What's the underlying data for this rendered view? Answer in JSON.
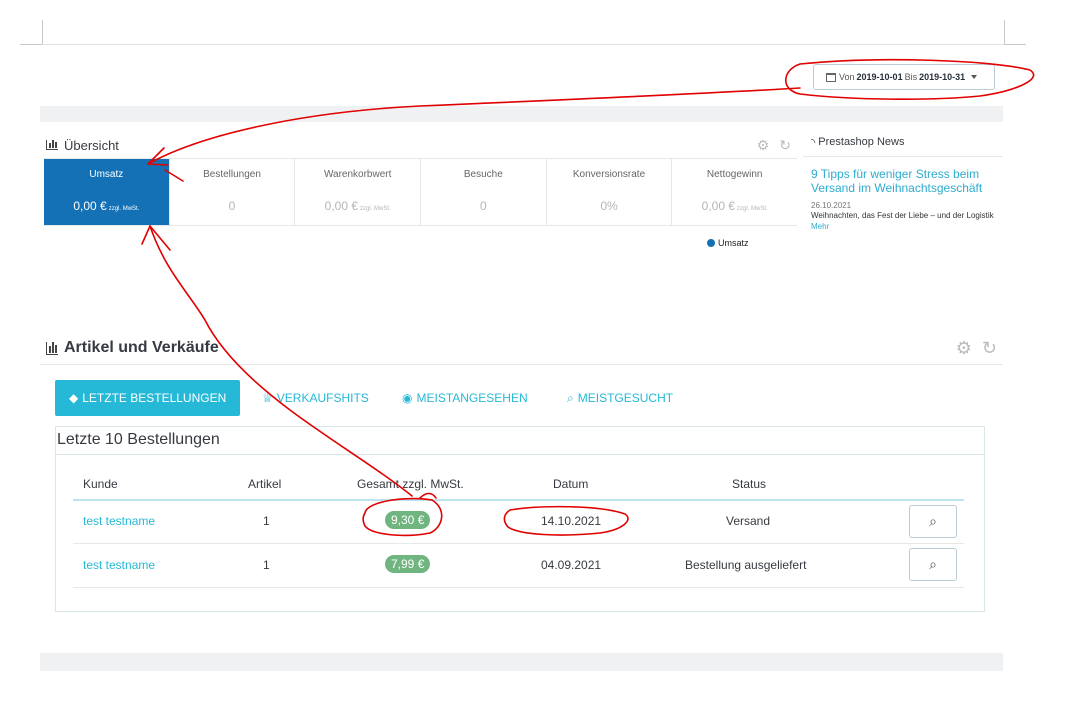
{
  "date_range": {
    "prefix": "Von",
    "from": "2019-10-01",
    "middle": "Bis",
    "to": "2019-10-31"
  },
  "overview": {
    "title": "Übersicht",
    "kpis": [
      {
        "label": "Umsatz",
        "value": "0,00 €",
        "tax": "zzgl. MwSt."
      },
      {
        "label": "Bestellungen",
        "value": "0",
        "tax": ""
      },
      {
        "label": "Warenkorbwert",
        "value": "0,00 €",
        "tax": "zzgl. MwSt."
      },
      {
        "label": "Besuche",
        "value": "0",
        "tax": ""
      },
      {
        "label": "Konversionsrate",
        "value": "0%",
        "tax": ""
      },
      {
        "label": "Nettogewinn",
        "value": "0,00 €",
        "tax": "zzgl. MwSt."
      }
    ],
    "legend": "Umsatz"
  },
  "news": {
    "title": "Prestashop News",
    "headline": "9 Tipps für weniger Stress beim Versand im Weihnachtsgeschäft",
    "date": "26.10.2021",
    "text": "Weihnachten, das Fest der Liebe – und der Logistik",
    "more": "Mehr"
  },
  "sales": {
    "title": "Artikel und Verkäufe",
    "tabs": [
      {
        "label": "LETZTE BESTELLUNGEN",
        "icon": "drop-icon"
      },
      {
        "label": "VERKAUFSHITS",
        "icon": "trophy-icon"
      },
      {
        "label": "MEISTANGESEHEN",
        "icon": "eye-icon"
      },
      {
        "label": "MEISTGESUCHT",
        "icon": "search-icon"
      }
    ],
    "orders_title": "Letzte 10 Bestellungen",
    "columns": [
      "Kunde",
      "Artikel",
      "Gesamt zzgl. MwSt.",
      "Datum",
      "Status"
    ],
    "rows": [
      {
        "customer": "test testname",
        "items": "1",
        "total": "9,30 €",
        "date": "14.10.2021",
        "status": "Versand"
      },
      {
        "customer": "test testname",
        "items": "1",
        "total": "7,99 €",
        "date": "04.09.2021",
        "status": "Bestellung ausgeliefert"
      }
    ]
  },
  "colors": {
    "accent": "#25b9d7",
    "kpi_active": "#1571b5",
    "badge": "#70b580",
    "annotation": "#e00000"
  }
}
